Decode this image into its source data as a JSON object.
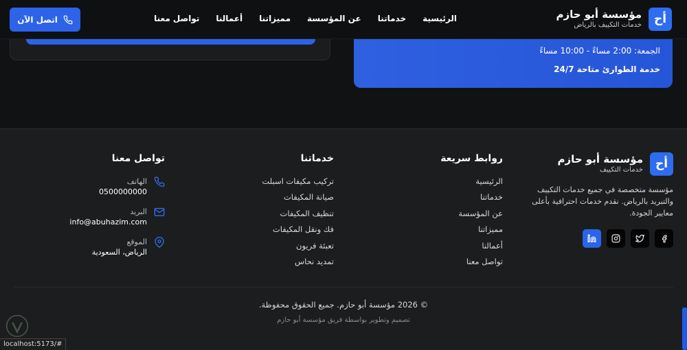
{
  "header": {
    "brand_title": "مؤسسة أبو حازم",
    "brand_subtitle": "خدمات التكييف بالرياض",
    "logo_text": "أح",
    "nav": [
      "الرئيسية",
      "خدماتنا",
      "عن المؤسسة",
      "مميزاتنا",
      "أعمالنا",
      "تواصل معنا"
    ],
    "cta_label": "اتصل الآن"
  },
  "hours_card": {
    "line1": "الجمعة: 2:00 مساءً - 10:00 مساءً",
    "line2": "خدمة الطوارئ متاحة 24/7"
  },
  "footer": {
    "brand_title": "مؤسسة أبو حازم",
    "brand_subtitle": "خدمات التكييف",
    "logo_text": "أح",
    "description": "مؤسسة متخصصة في جميع خدمات التكييف والتبريد بالرياض. نقدم خدمات احترافية بأعلى معايير الجودة.",
    "socials": [
      "facebook-icon",
      "twitter-icon",
      "instagram-icon",
      "linkedin-icon"
    ],
    "quick_links": {
      "title": "روابط سريعة",
      "items": [
        "الرئيسية",
        "خدماتنا",
        "عن المؤسسة",
        "مميزاتنا",
        "أعمالنا",
        "تواصل معنا"
      ]
    },
    "services": {
      "title": "خدماتنا",
      "items": [
        "تركيب مكيفات اسبلت",
        "صيانة المكيفات",
        "تنظيف المكيفات",
        "فك ونقل المكيفات",
        "تعبئة فريون",
        "تمديد نحاس"
      ]
    },
    "contact": {
      "title": "تواصل معنا",
      "phone_label": "الهاتف",
      "phone_value": "0500000000",
      "email_label": "البريد",
      "email_value": "info@abuhazim.com",
      "location_label": "الموقع",
      "location_value": "الرياض، السعودية"
    },
    "copyright": "© 2026 مؤسسة أبو حازم. جميع الحقوق محفوظة.",
    "credits": "تصميم وتطوير بواسطة فريق مؤسسة أبو حازم"
  },
  "status_url": "localhost:5173/#",
  "colors": {
    "accent": "#2c63e8",
    "background": "#111214",
    "footer": "#1c1d1f"
  }
}
